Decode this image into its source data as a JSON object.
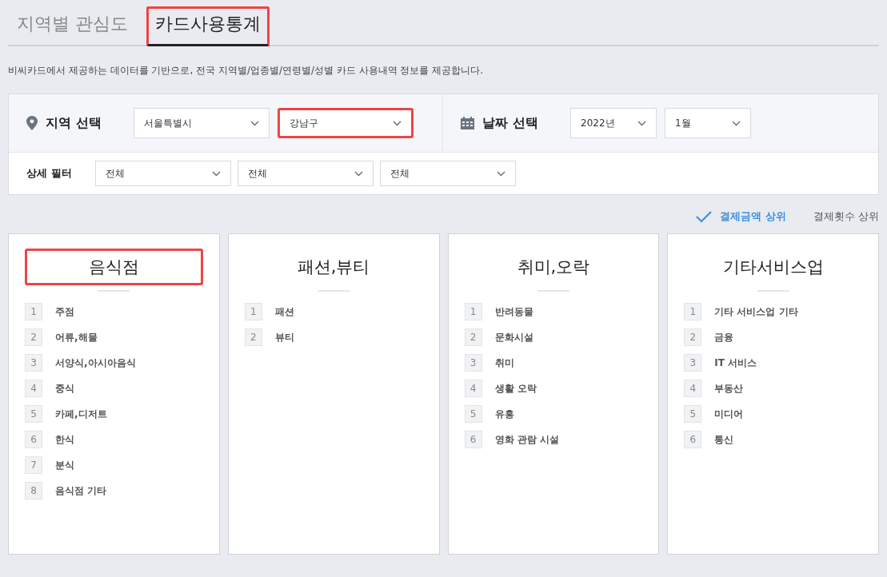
{
  "tabs": [
    {
      "label": "지역별 관심도",
      "selected": false,
      "highlighted": false
    },
    {
      "label": "카드사용통계",
      "selected": true,
      "highlighted": true
    }
  ],
  "description": "비씨카드에서 제공하는 데이터를 기반으로, 전국 지역별/업종별/연령별/성별 카드 사용내역 정보를 제공합니다.",
  "region": {
    "label": "지역 선택",
    "selects": [
      {
        "value": "서울특별시",
        "highlighted": false
      },
      {
        "value": "강남구",
        "highlighted": true
      }
    ]
  },
  "date": {
    "label": "날짜 선택",
    "selects": [
      {
        "value": "2022년",
        "highlighted": false
      },
      {
        "value": "1월",
        "highlighted": false
      }
    ]
  },
  "detail_filter": {
    "label": "상세 필터",
    "selects": [
      {
        "value": "전체"
      },
      {
        "value": "전체"
      },
      {
        "value": "전체"
      }
    ]
  },
  "sort_options": [
    {
      "label": "결제금액 상위",
      "selected": true
    },
    {
      "label": "결제횟수 상위",
      "selected": false
    }
  ],
  "categories": [
    {
      "title": "음식점",
      "highlighted": true,
      "items": [
        {
          "rank": "1",
          "name": "주점"
        },
        {
          "rank": "2",
          "name": "어류,해물"
        },
        {
          "rank": "3",
          "name": "서양식,아시아음식"
        },
        {
          "rank": "4",
          "name": "중식"
        },
        {
          "rank": "5",
          "name": "카페,디저트"
        },
        {
          "rank": "6",
          "name": "한식"
        },
        {
          "rank": "7",
          "name": "분식"
        },
        {
          "rank": "8",
          "name": "음식점 기타"
        }
      ]
    },
    {
      "title": "패션,뷰티",
      "highlighted": false,
      "items": [
        {
          "rank": "1",
          "name": "패션"
        },
        {
          "rank": "2",
          "name": "뷰티"
        }
      ]
    },
    {
      "title": "취미,오락",
      "highlighted": false,
      "items": [
        {
          "rank": "1",
          "name": "반려동물"
        },
        {
          "rank": "2",
          "name": "문화시설"
        },
        {
          "rank": "3",
          "name": "취미"
        },
        {
          "rank": "4",
          "name": "생활 오락"
        },
        {
          "rank": "5",
          "name": "유흥"
        },
        {
          "rank": "6",
          "name": "영화 관람 시설"
        }
      ]
    },
    {
      "title": "기타서비스업",
      "highlighted": false,
      "items": [
        {
          "rank": "1",
          "name": "기타 서비스업 기타"
        },
        {
          "rank": "2",
          "name": "금융"
        },
        {
          "rank": "3",
          "name": "IT 서비스"
        },
        {
          "rank": "4",
          "name": "부동산"
        },
        {
          "rank": "5",
          "name": "미디어"
        },
        {
          "rank": "6",
          "name": "통신"
        }
      ]
    }
  ]
}
